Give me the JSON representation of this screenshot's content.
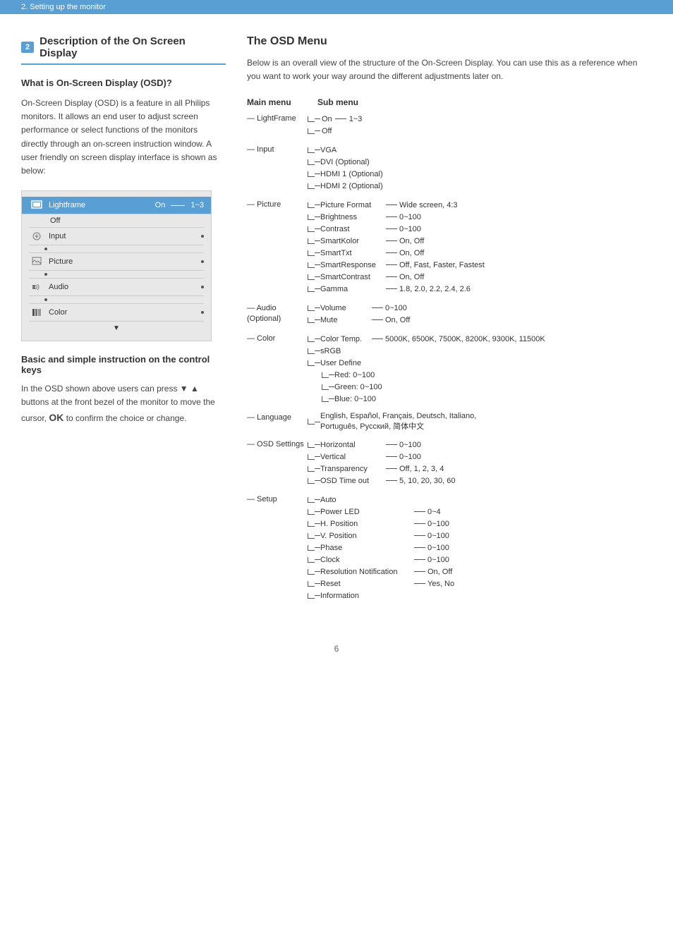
{
  "banner": {
    "text": "2. Setting up the monitor"
  },
  "left": {
    "section_num": "2",
    "section_title": "Description of the On Screen Display",
    "what_is_title": "What is On-Screen Display (OSD)?",
    "body_text": "On-Screen Display (OSD) is a feature in all Philips monitors. It allows an end user to adjust screen performance or select functions of the monitors directly through an on-screen instruction window. A user friendly on screen display interface is shown as below:",
    "osd_items": [
      {
        "icon": "🖼",
        "label": "Lightframe",
        "active": true,
        "right_on": "On",
        "right_off": "Off",
        "dots": true
      },
      {
        "icon": "📥",
        "label": "Input",
        "active": false
      },
      {
        "icon": "🖼",
        "label": "Picture",
        "active": false
      },
      {
        "icon": "🔊",
        "label": "Audio",
        "active": false
      },
      {
        "icon": "🎨",
        "label": "Color",
        "active": false
      }
    ],
    "control_heading": "Basic and simple instruction on the control keys",
    "control_text_1": "In the OSD shown above users can press ▼ ▲ buttons at the front bezel of the monitor to move the cursor,",
    "control_ok": "OK",
    "control_text_2": "to confirm the choice or change."
  },
  "right": {
    "osd_menu_title": "The OSD Menu",
    "osd_menu_desc": "Below is an overall view of the structure of the On-Screen Display. You can use this as a reference when you want to work your way around the different adjustments later on.",
    "col_main": "Main menu",
    "col_sub": "Sub menu",
    "menu_items": [
      {
        "main": "LightFrame",
        "subs": [
          {
            "name": "On",
            "dash": true,
            "val": "1~3",
            "indent": 0,
            "is_last": false
          },
          {
            "name": "Off",
            "dash": false,
            "val": "",
            "indent": 0,
            "is_last": true
          }
        ]
      },
      {
        "main": "Input",
        "subs": [
          {
            "name": "VGA",
            "dash": false,
            "val": "",
            "indent": 0,
            "is_last": false
          },
          {
            "name": "DVI (Optional)",
            "dash": false,
            "val": "",
            "indent": 0,
            "is_last": false
          },
          {
            "name": "HDMI 1 (Optional)",
            "dash": false,
            "val": "",
            "indent": 0,
            "is_last": false
          },
          {
            "name": "HDMI 2 (Optional)",
            "dash": false,
            "val": "",
            "indent": 0,
            "is_last": true
          }
        ]
      },
      {
        "main": "Picture",
        "subs": [
          {
            "name": "Picture Format",
            "dash": true,
            "val": "Wide screen, 4:3",
            "indent": 0,
            "is_last": false
          },
          {
            "name": "Brightness",
            "dash": true,
            "val": "0~100",
            "indent": 0,
            "is_last": false
          },
          {
            "name": "Contrast",
            "dash": true,
            "val": "0~100",
            "indent": 0,
            "is_last": false
          },
          {
            "name": "SmartKolor",
            "dash": true,
            "val": "On, Off",
            "indent": 0,
            "is_last": false
          },
          {
            "name": "SmartTxt",
            "dash": true,
            "val": "On, Off",
            "indent": 0,
            "is_last": false
          },
          {
            "name": "SmartResponse",
            "dash": true,
            "val": "Off, Fast, Faster, Fastest",
            "indent": 0,
            "is_last": false
          },
          {
            "name": "SmartContrast",
            "dash": true,
            "val": "On, Off",
            "indent": 0,
            "is_last": false
          },
          {
            "name": "Gamma",
            "dash": true,
            "val": "1.8, 2.0, 2.2, 2.4, 2.6",
            "indent": 0,
            "is_last": true
          }
        ]
      },
      {
        "main": "Audio (Optional)",
        "subs": [
          {
            "name": "Volume",
            "dash": true,
            "val": "0~100",
            "indent": 0,
            "is_last": false
          },
          {
            "name": "Mute",
            "dash": true,
            "val": "On, Off",
            "indent": 0,
            "is_last": true
          }
        ]
      },
      {
        "main": "Color",
        "subs": [
          {
            "name": "Color Temp.",
            "dash": true,
            "val": "5000K, 6500K, 7500K, 8200K, 9300K, 11500K",
            "indent": 0,
            "is_last": false
          },
          {
            "name": "sRGB",
            "dash": false,
            "val": "",
            "indent": 0,
            "is_last": false
          },
          {
            "name": "User Define",
            "dash": false,
            "val": "",
            "indent": 0,
            "is_last": true
          },
          {
            "name": "Red: 0~100",
            "dash": false,
            "val": "",
            "indent": 1,
            "is_last": false
          },
          {
            "name": "Green: 0~100",
            "dash": false,
            "val": "",
            "indent": 1,
            "is_last": false
          },
          {
            "name": "Blue: 0~100",
            "dash": false,
            "val": "",
            "indent": 1,
            "is_last": true
          }
        ]
      },
      {
        "main": "Language",
        "subs": [
          {
            "name": "English, Español, Français, Deutsch, Italiano, Português, Русский, 简体中文",
            "dash": false,
            "val": "",
            "indent": 0,
            "is_last": true,
            "multiline": true
          }
        ]
      },
      {
        "main": "OSD Settings",
        "subs": [
          {
            "name": "Horizontal",
            "dash": true,
            "val": "0~100",
            "indent": 0,
            "is_last": false
          },
          {
            "name": "Vertical",
            "dash": true,
            "val": "0~100",
            "indent": 0,
            "is_last": false
          },
          {
            "name": "Transparency",
            "dash": true,
            "val": "Off, 1, 2, 3, 4",
            "indent": 0,
            "is_last": false
          },
          {
            "name": "OSD Time out",
            "dash": true,
            "val": "5, 10, 20, 30, 60",
            "indent": 0,
            "is_last": true
          }
        ]
      },
      {
        "main": "Setup",
        "subs": [
          {
            "name": "Auto",
            "dash": false,
            "val": "",
            "indent": 0,
            "is_last": false
          },
          {
            "name": "Power LED",
            "dash": true,
            "val": "0~4",
            "indent": 0,
            "is_last": false
          },
          {
            "name": "H. Position",
            "dash": true,
            "val": "0~100",
            "indent": 0,
            "is_last": false
          },
          {
            "name": "V. Position",
            "dash": true,
            "val": "0~100",
            "indent": 0,
            "is_last": false
          },
          {
            "name": "Phase",
            "dash": true,
            "val": "0~100",
            "indent": 0,
            "is_last": false
          },
          {
            "name": "Clock",
            "dash": true,
            "val": "0~100",
            "indent": 0,
            "is_last": false
          },
          {
            "name": "Resolution Notification",
            "dash": true,
            "val": "On, Off",
            "indent": 0,
            "is_last": false
          },
          {
            "name": "Reset",
            "dash": true,
            "val": "Yes, No",
            "indent": 0,
            "is_last": false
          },
          {
            "name": "Information",
            "dash": false,
            "val": "",
            "indent": 0,
            "is_last": true
          }
        ]
      }
    ]
  },
  "page_number": "6"
}
